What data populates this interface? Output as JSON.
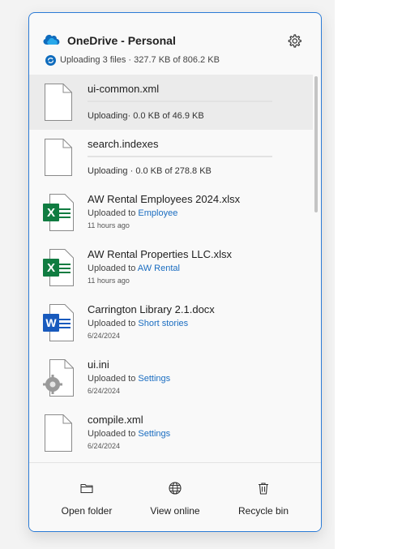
{
  "header": {
    "title": "OneDrive - Personal",
    "status": "Uploading 3 files · 327.7 KB of 806.2 KB"
  },
  "files": [
    {
      "name": "ui-common.xml",
      "type": "generic",
      "state": "uploading",
      "progress_line": "Uploading· 0.0 KB of 46.9 KB",
      "progress": 0
    },
    {
      "name": "search.indexes",
      "type": "generic",
      "state": "uploading",
      "progress_line": "Uploading · 0.0 KB of 278.8 KB",
      "progress": 0
    },
    {
      "name": "AW Rental Employees 2024.xlsx",
      "type": "excel",
      "state": "uploaded",
      "uploaded_prefix": "Uploaded to",
      "folder": "Employee",
      "time": "11 hours ago"
    },
    {
      "name": "AW Rental Properties LLC.xlsx",
      "type": "excel",
      "state": "uploaded",
      "uploaded_prefix": "Uploaded to",
      "folder": "AW Rental",
      "time": "11 hours ago"
    },
    {
      "name": "Carrington Library 2.1.docx",
      "type": "word",
      "state": "uploaded",
      "uploaded_prefix": "Uploaded to",
      "folder": "Short stories",
      "time": "6/24/2024"
    },
    {
      "name": "ui.ini",
      "type": "settings",
      "state": "uploaded",
      "uploaded_prefix": "Uploaded to",
      "folder": "Settings",
      "time": "6/24/2024"
    },
    {
      "name": "compile.xml",
      "type": "generic",
      "state": "uploaded",
      "uploaded_prefix": "Uploaded to",
      "folder": "Settings",
      "time": "6/24/2024"
    }
  ],
  "footer": {
    "open_folder": "Open folder",
    "view_online": "View online",
    "recycle_bin": "Recycle bin"
  },
  "icons": {
    "header": [
      "onedrive-cloud-icon",
      "gear-icon",
      "sync-icon"
    ],
    "footer": [
      "folder-icon",
      "globe-icon",
      "trash-icon"
    ]
  },
  "colors": {
    "accent": "#2b7bd6",
    "excel": "#107c41",
    "word": "#185abd",
    "link": "#1a6dc1"
  }
}
